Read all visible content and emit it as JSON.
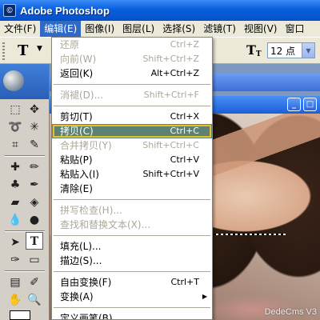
{
  "window": {
    "title": "Adobe Photoshop",
    "app_icon_glyph": "©"
  },
  "menubar": {
    "items": [
      {
        "label": "文件(F)"
      },
      {
        "label": "编辑(E)",
        "active": true
      },
      {
        "label": "图像(I)"
      },
      {
        "label": "图层(L)"
      },
      {
        "label": "选择(S)"
      },
      {
        "label": "滤镜(T)"
      },
      {
        "label": "视图(V)"
      },
      {
        "label": "窗口"
      }
    ]
  },
  "options_bar": {
    "tool_glyph": "T",
    "tool_arrow": "▼",
    "orientation_glyph": "T",
    "font_size_value": "12 点",
    "font_size_arrow": "▼"
  },
  "edit_menu": {
    "entries": [
      {
        "label": "还原",
        "shortcut": "Ctrl+Z",
        "disabled": true
      },
      {
        "label": "向前(W)",
        "shortcut": "Shift+Ctrl+Z",
        "disabled": true
      },
      {
        "label": "返回(K)",
        "shortcut": "Alt+Ctrl+Z"
      },
      {
        "separator": true
      },
      {
        "label": "消褪(D)...",
        "shortcut": "Shift+Ctrl+F",
        "disabled": true
      },
      {
        "separator": true
      },
      {
        "label": "剪切(T)",
        "shortcut": "Ctrl+X"
      },
      {
        "label": "拷贝(C)",
        "shortcut": "Ctrl+C",
        "highlighted": true
      },
      {
        "label": "合并拷贝(Y)",
        "shortcut": "Shift+Ctrl+C",
        "disabled": true
      },
      {
        "label": "粘贴(P)",
        "shortcut": "Ctrl+V"
      },
      {
        "label": "粘贴入(I)",
        "shortcut": "Shift+Ctrl+V"
      },
      {
        "label": "清除(E)",
        "shortcut": ""
      },
      {
        "separator": true
      },
      {
        "label": "拼写检查(H)...",
        "shortcut": "",
        "disabled": true
      },
      {
        "label": "查找和替换文本(X)...",
        "shortcut": "",
        "disabled": true
      },
      {
        "separator": true
      },
      {
        "label": "填充(L)...",
        "shortcut": ""
      },
      {
        "label": "描边(S)...",
        "shortcut": ""
      },
      {
        "separator": true
      },
      {
        "label": "自由变换(F)",
        "shortcut": "Ctrl+T"
      },
      {
        "label": "变换(A)",
        "shortcut": "",
        "submenu": true
      },
      {
        "separator": true
      },
      {
        "label": "定义画笔(B)...",
        "shortcut": ""
      }
    ]
  },
  "document": {
    "minimize_glyph": "_",
    "maximize_glyph": "□",
    "close_glyph": "×",
    "watermark": "DedeCms V3"
  },
  "colors": {
    "title_blue": "#0a5fdd",
    "menu_highlight": "#5d8272",
    "highlight_outline": "#e4c02a",
    "menubar_active": "#316ac5"
  }
}
